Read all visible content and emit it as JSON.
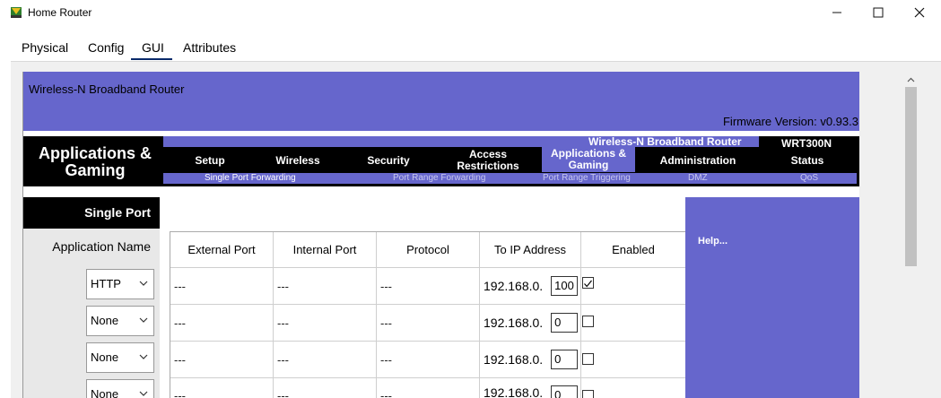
{
  "window": {
    "title": "Home Router"
  },
  "tabs": [
    {
      "label": "Physical"
    },
    {
      "label": "Config"
    },
    {
      "label": "GUI"
    },
    {
      "label": "Attributes"
    }
  ],
  "active_tab": "GUI",
  "router": {
    "name": "Wireless-N Broadband Router",
    "firmware": "Firmware Version: v0.93.3",
    "section": "Applications & Gaming",
    "product": "Wireless-N Broadband Router",
    "model": "WRT300N",
    "nav": [
      {
        "label": "Setup"
      },
      {
        "label": "Wireless"
      },
      {
        "label": "Security"
      },
      {
        "label": "Access Restrictions"
      },
      {
        "label": "Applications & Gaming"
      },
      {
        "label": "Administration"
      },
      {
        "label": "Status"
      }
    ],
    "subnav": [
      {
        "label": "Single Port Forwarding"
      },
      {
        "label": "Port Range Forwarding"
      },
      {
        "label": "Port Range Triggering"
      },
      {
        "label": "DMZ"
      },
      {
        "label": "QoS"
      }
    ],
    "left": {
      "head": "Single Port",
      "app_name_label": "Application Name"
    },
    "help": "Help...",
    "table": {
      "headers": [
        "External Port",
        "Internal Port",
        "Protocol",
        "To IP Address",
        "Enabled"
      ],
      "rows": [
        {
          "app": "HTTP",
          "ext": "---",
          "int": "---",
          "proto": "---",
          "ip_prefix": "192.168.0.",
          "ip_last": "100",
          "enabled": true
        },
        {
          "app": "None",
          "ext": "---",
          "int": "---",
          "proto": "---",
          "ip_prefix": "192.168.0.",
          "ip_last": "0",
          "enabled": false
        },
        {
          "app": "None",
          "ext": "---",
          "int": "---",
          "proto": "---",
          "ip_prefix": "192.168.0.",
          "ip_last": "0",
          "enabled": false
        },
        {
          "app": "None",
          "ext": "---",
          "int": "---",
          "proto": "---",
          "ip_prefix": "192.168.0.",
          "ip_last": "0",
          "enabled": false
        }
      ]
    }
  },
  "colors": {
    "accent": "#6666cc",
    "nav_bg": "#000000"
  }
}
